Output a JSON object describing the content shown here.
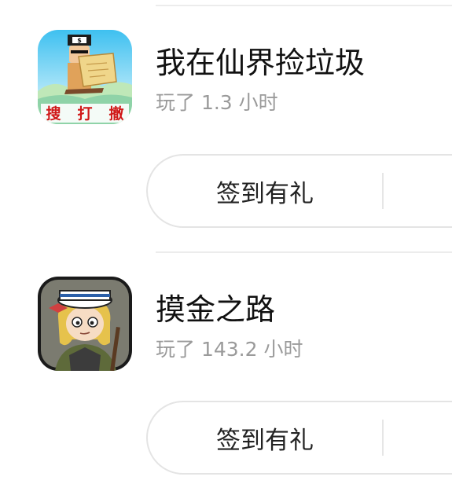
{
  "games": [
    {
      "title": "我在仙界捡垃圾",
      "playtime": "玩了 1.3 小时",
      "action_label": "签到有礼",
      "icon": "treasure-map-game-icon",
      "icon_text": [
        "搜",
        "打",
        "撤"
      ]
    },
    {
      "title": "摸金之路",
      "playtime": "玩了 143.2 小时",
      "action_label": "签到有礼",
      "icon": "sailor-girl-game-icon"
    }
  ],
  "colors": {
    "title": "#111111",
    "subtitle": "#9a9a9a",
    "border": "#e4e4e4",
    "divider": "#ececec"
  }
}
